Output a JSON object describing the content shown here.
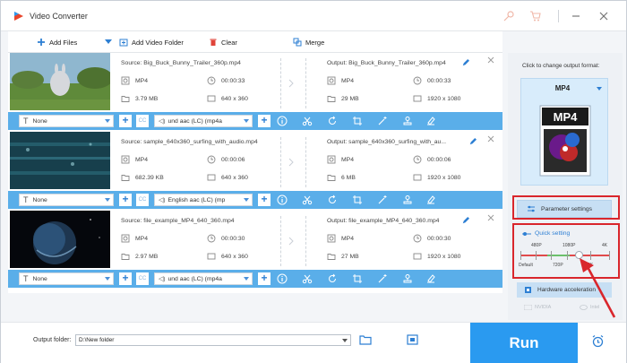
{
  "app": {
    "title": "Video Converter"
  },
  "toolbar": {
    "add_files": "Add Files",
    "add_video_folder": "Add Video Folder",
    "clear": "Clear",
    "merge": "Merge"
  },
  "files": [
    {
      "source": "Source: Big_Buck_Bunny_Trailer_360p.mp4",
      "output": "Output: Big_Buck_Bunny_Trailer_360p.mp4",
      "src_format": "MP4",
      "src_duration": "00:00:33",
      "src_size": "3.79 MB",
      "src_resolution": "640 x 360",
      "out_format": "MP4",
      "out_duration": "00:00:33",
      "out_size": "29 MB",
      "out_resolution": "1920 x 1080",
      "subtitle": "None",
      "audio": "und aac (LC) (mp4a"
    },
    {
      "source": "Source: sample_640x360_surfing_with_audio.mp4",
      "output": "Output: sample_640x360_surfing_with_au...",
      "src_format": "MP4",
      "src_duration": "00:00:06",
      "src_size": "682.39 KB",
      "src_resolution": "640 x 360",
      "out_format": "MP4",
      "out_duration": "00:00:06",
      "out_size": "6 MB",
      "out_resolution": "1920 x 1080",
      "subtitle": "None",
      "audio": "English aac (LC) (mp"
    },
    {
      "source": "Source: file_example_MP4_640_360.mp4",
      "output": "Output: file_example_MP4_640_360.mp4",
      "src_format": "MP4",
      "src_duration": "00:00:30",
      "src_size": "2.97 MB",
      "src_resolution": "640 x 360",
      "out_format": "MP4",
      "out_duration": "00:00:30",
      "out_size": "27 MB",
      "out_resolution": "1920 x 1080",
      "subtitle": "None",
      "audio": "und aac (LC) (mp4a"
    }
  ],
  "controls": {
    "cc": "CC"
  },
  "right_panel": {
    "hint": "Click to change output format:",
    "format": "MP4",
    "format_icon_text": "MP4",
    "parameter_settings": "Parameter settings",
    "quick_setting": "Quick setting",
    "quick_top_labels": [
      "480P",
      "1080P",
      "4K"
    ],
    "quick_bottom_labels": [
      "Default",
      "720P",
      "2K"
    ],
    "quick_level": "1080P",
    "hardware_acceleration": "Hardware acceleration",
    "vendors": [
      "NVIDIA",
      "Intel"
    ]
  },
  "bottom": {
    "output_folder_label": "Output folder:",
    "output_folder_value": "D:\\New folder",
    "run": "Run"
  },
  "colors": {
    "accent": "#2a9af0",
    "control_bar": "#5aaee9",
    "highlight": "#d9262c"
  }
}
